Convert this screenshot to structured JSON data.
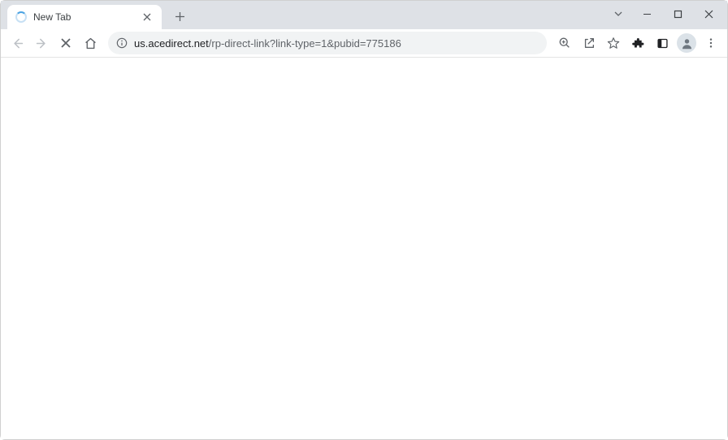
{
  "tab": {
    "title": "New Tab"
  },
  "url": {
    "domain": "us.acedirect.net",
    "path": "/rp-direct-link?link-type=1&pubid=775186"
  }
}
